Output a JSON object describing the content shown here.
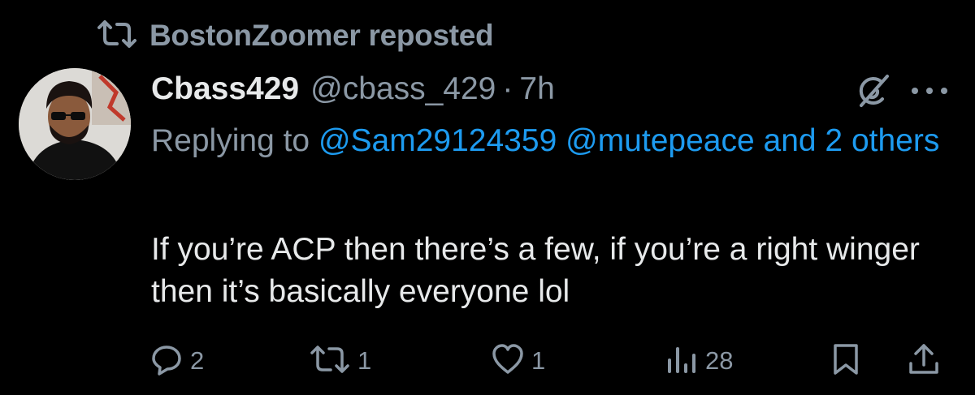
{
  "repost": {
    "label": "BostonZoomer reposted",
    "icon": "retweet-icon"
  },
  "tweet": {
    "display_name": "Cbass429",
    "handle": "@cbass_429",
    "separator": "·",
    "time": "7h",
    "replying_prefix": "Replying to ",
    "mention_1": "@Sam29124359",
    "mention_2": "@mutepeace",
    "mention_more": "and 2 others",
    "text": "If you’re ACP then there’s a few, if you’re a right winger then it’s basically everyone lol"
  },
  "actions": {
    "replies": "2",
    "retweets": "1",
    "likes": "1",
    "views": "28"
  },
  "icons": {
    "grok": "grok-icon",
    "more": "more-icon",
    "reply": "reply-icon",
    "retweet": "retweet-icon",
    "like": "heart-icon",
    "views": "views-icon",
    "bookmark": "bookmark-icon",
    "share": "share-icon"
  },
  "colors": {
    "background": "#000000",
    "text_primary": "#e7e9ea",
    "text_secondary": "#8b98a5",
    "accent": "#1d9bf0"
  }
}
